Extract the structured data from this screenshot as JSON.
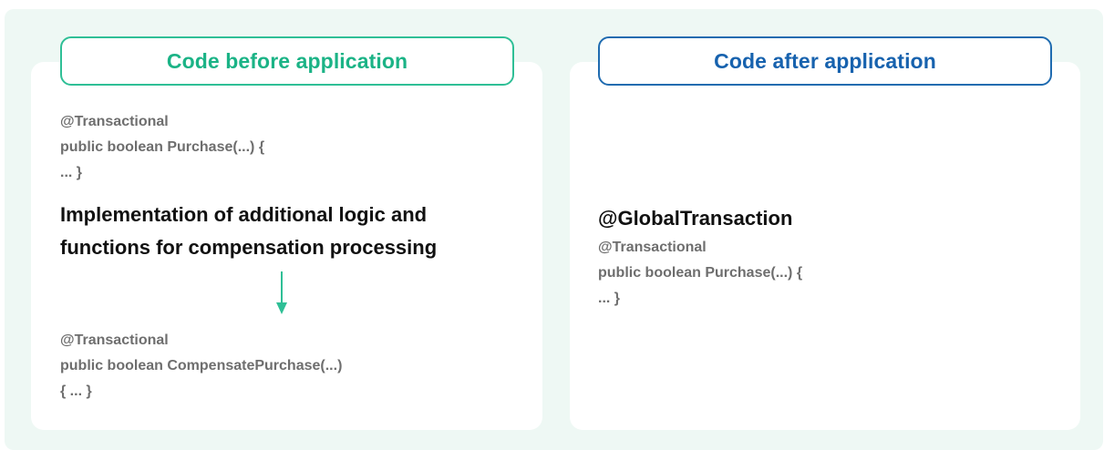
{
  "left": {
    "header": "Code before application",
    "code_top": [
      "@Transactional",
      "public boolean Purchase(...) {",
      "... }"
    ],
    "note": [
      "Implementation of additional logic and",
      "functions for compensation processing"
    ],
    "code_bottom": [
      "@Transactional",
      "public boolean CompensatePurchase(...)",
      "{ ... }"
    ]
  },
  "right": {
    "header": "Code after application",
    "annotation": "@GlobalTransaction",
    "code": [
      "@Transactional",
      "public boolean Purchase(...) {",
      "... }"
    ]
  },
  "colors": {
    "background": "#eef8f4",
    "left_accent": "#2fbf96",
    "right_accent": "#1f6bb0",
    "code_text": "#6e6e6e"
  }
}
